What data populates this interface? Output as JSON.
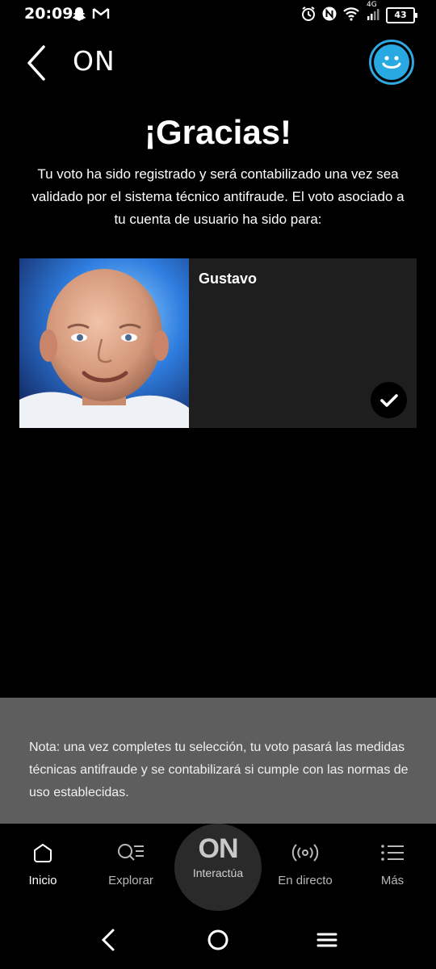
{
  "status_bar": {
    "time": "20:09",
    "network": "4G",
    "battery": "43",
    "icons": [
      "snapchat-icon",
      "gmail-icon",
      "alarm-icon",
      "nfc-icon",
      "wifi-icon",
      "signal-icon",
      "battery-icon"
    ]
  },
  "header": {
    "title": "ON",
    "back_icon": "chevron-left-icon",
    "profile_icon": "smiley-avatar-icon",
    "accent": "#29a9e1"
  },
  "confirmation": {
    "title": "¡Gracias!",
    "message": "Tu voto ha sido registrado y será contabilizado una vez sea validado por el sistema técnico antifraude. El voto asociado a tu cuenta de usuario ha sido para:"
  },
  "vote_card": {
    "name": "Gustavo",
    "selected": true,
    "check_icon": "check-icon"
  },
  "note": {
    "text": "Nota: una vez completes tu selección, tu voto pasará las medidas técnicas antifraude y se contabilizará si cumple con las normas de uso establecidas."
  },
  "bottom_nav": {
    "items": [
      {
        "label": "Inicio",
        "icon": "home-icon",
        "active": true
      },
      {
        "label": "Explorar",
        "icon": "search-list-icon",
        "active": false
      },
      {
        "label": "Interactúa",
        "icon": "on-logo-icon",
        "logo": "ON",
        "active": false
      },
      {
        "label": "En directo",
        "icon": "broadcast-icon",
        "active": false
      },
      {
        "label": "Más",
        "icon": "menu-list-icon",
        "active": false
      }
    ]
  },
  "system_nav": {
    "icons": [
      "back-icon",
      "home-circle-icon",
      "recents-icon"
    ]
  }
}
